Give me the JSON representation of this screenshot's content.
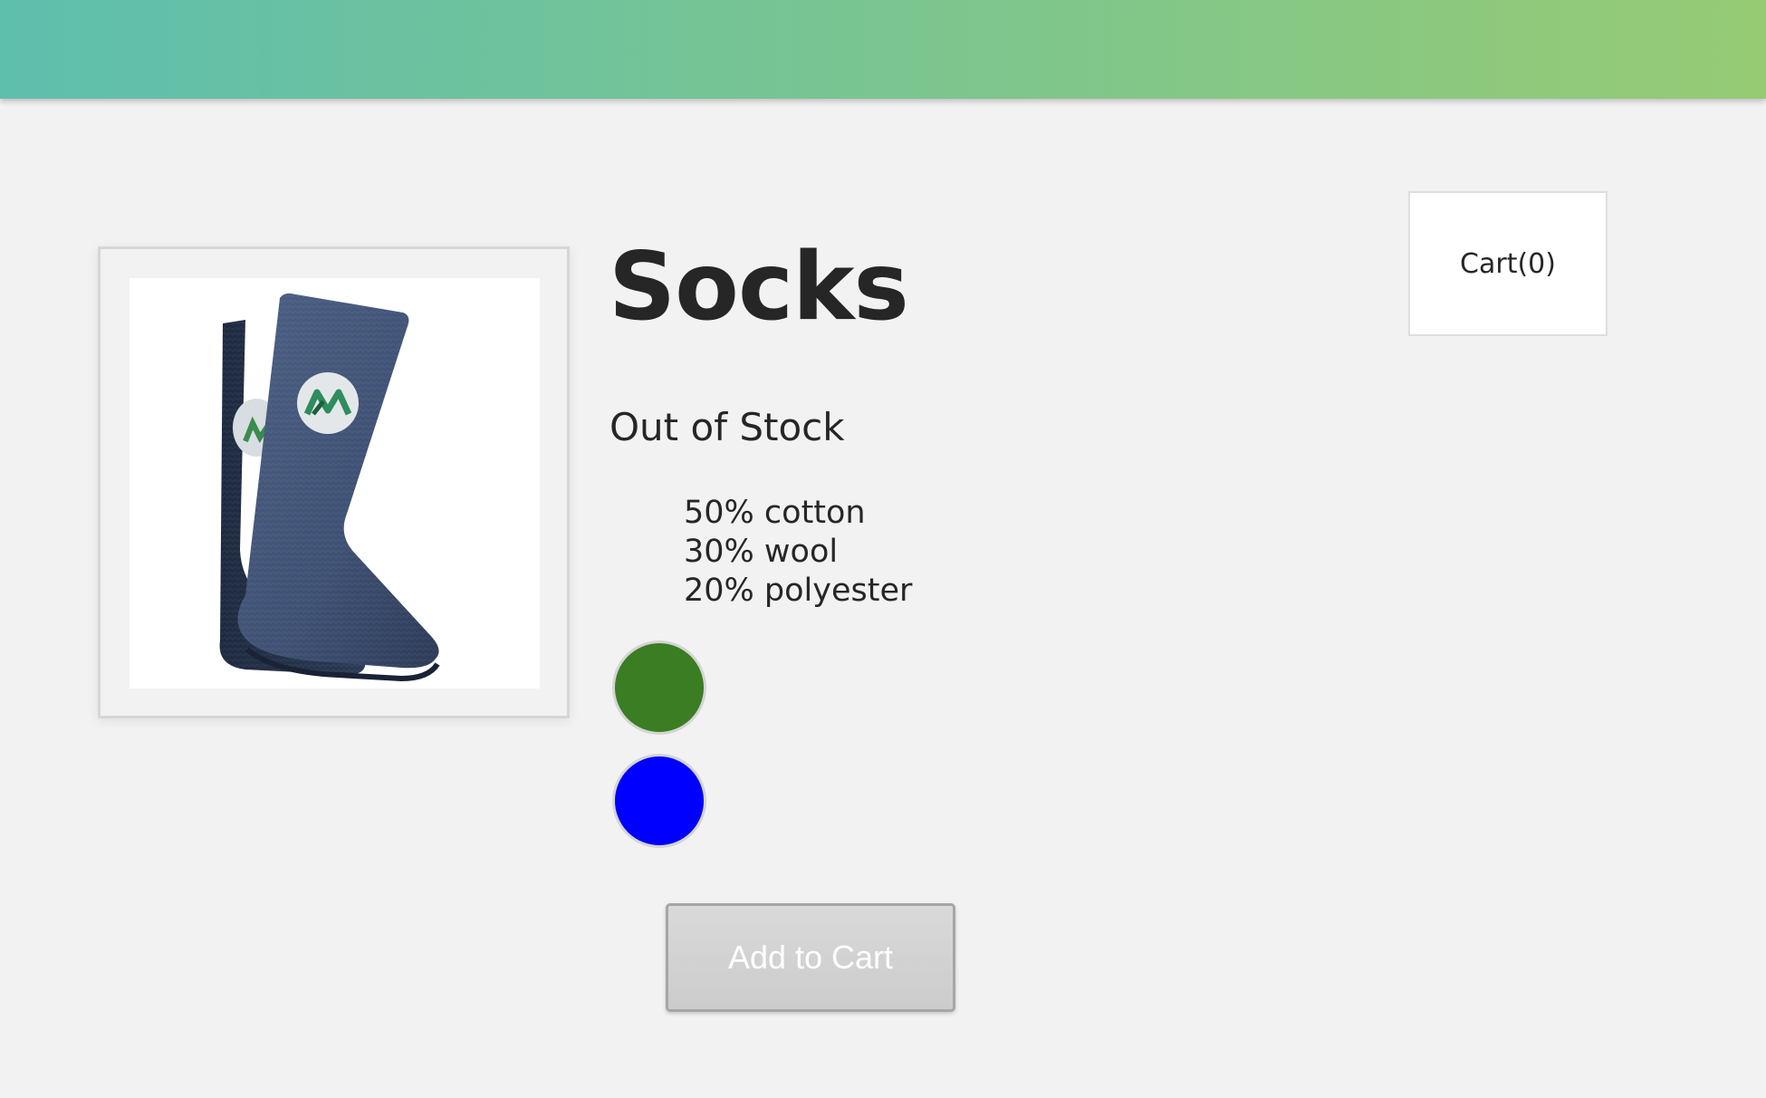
{
  "header": {
    "gradient_start": "#5ebfad",
    "gradient_end": "#96cb74"
  },
  "cart": {
    "label": "Cart(0)"
  },
  "product": {
    "title": "Socks",
    "stock_status": "Out of Stock",
    "materials": [
      "50% cotton",
      "30% wool",
      "20% polyester"
    ],
    "image_icon": "socks-product-image",
    "variants": [
      {
        "color": "#3a7d22"
      },
      {
        "color": "#0000ff"
      }
    ],
    "add_to_cart_label": "Add to Cart"
  }
}
